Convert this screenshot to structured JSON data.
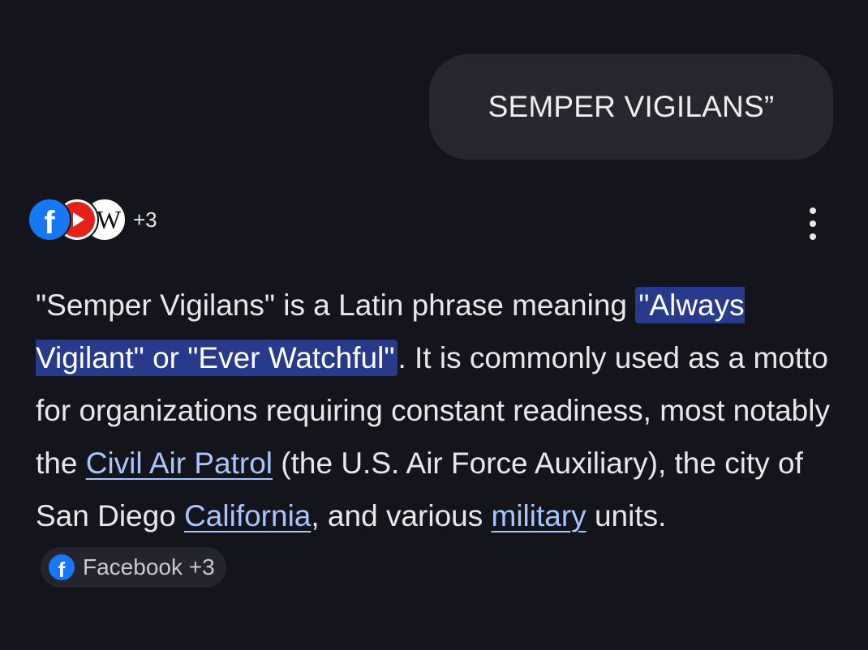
{
  "query": {
    "text": "SEMPER VIGILANS”"
  },
  "sources": {
    "icons": [
      "facebook-icon",
      "youtube-icon",
      "wikipedia-icon"
    ],
    "wiki_letter": "W",
    "more_count": "+3"
  },
  "answer": {
    "part1": "\"Semper Vigilans\" is a Latin phrase meaning ",
    "highlight": "\"Always Vigilant\" or \"Ever Watchful\"",
    "part2": ". It is commonly used as a motto for organizations requiring constant readiness, most notably the ",
    "link_civil_air_patrol": "Civil Air Patrol",
    "part3": " (the U.S. Air Force Auxiliary), the city of San Diego ",
    "link_california": "California",
    "part4": ", and various ",
    "link_military": "military",
    "part5": " units.",
    "citation_chip": "Facebook +3"
  },
  "colors": {
    "background": "#14151c",
    "bubble": "#27282f",
    "highlight_bg": "#283a8c",
    "link": "#a9c5ff",
    "facebook_blue": "#1877f2",
    "youtube_red": "#e62117"
  }
}
